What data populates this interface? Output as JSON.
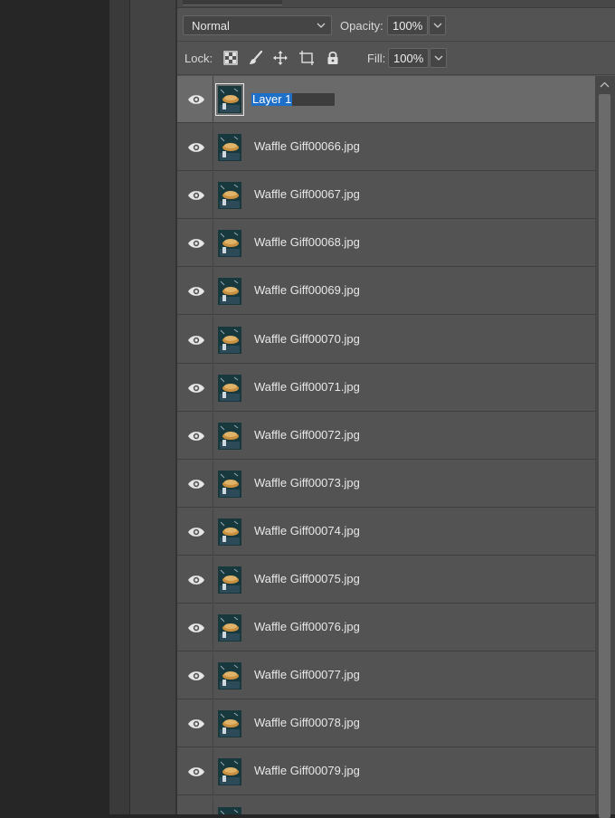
{
  "blend": {
    "mode": "Normal",
    "opacity_label": "Opacity:",
    "opacity_value": "100%"
  },
  "lock": {
    "label": "Lock:",
    "icons": [
      "transparency-lock-icon",
      "paintbrush-lock-icon",
      "move-lock-icon",
      "artboard-lock-icon",
      "padlock-icon"
    ],
    "fill_label": "Fill:",
    "fill_value": "100%"
  },
  "layers": [
    {
      "name": "Layer 1",
      "selected": true,
      "editing": true
    },
    {
      "name": "Waffle Giff00066.jpg"
    },
    {
      "name": "Waffle Giff00067.jpg"
    },
    {
      "name": "Waffle Giff00068.jpg"
    },
    {
      "name": "Waffle Giff00069.jpg"
    },
    {
      "name": "Waffle Giff00070.jpg"
    },
    {
      "name": "Waffle Giff00071.jpg"
    },
    {
      "name": "Waffle Giff00072.jpg"
    },
    {
      "name": "Waffle Giff00073.jpg"
    },
    {
      "name": "Waffle Giff00074.jpg"
    },
    {
      "name": "Waffle Giff00075.jpg"
    },
    {
      "name": "Waffle Giff00076.jpg"
    },
    {
      "name": "Waffle Giff00077.jpg"
    },
    {
      "name": "Waffle Giff00078.jpg"
    },
    {
      "name": "Waffle Giff00079.jpg"
    },
    {
      "name": ""
    }
  ],
  "colors": {
    "panel_bg": "#535353",
    "selected_row": "#6a6a6a",
    "text_highlight": "#1e6fc7"
  }
}
